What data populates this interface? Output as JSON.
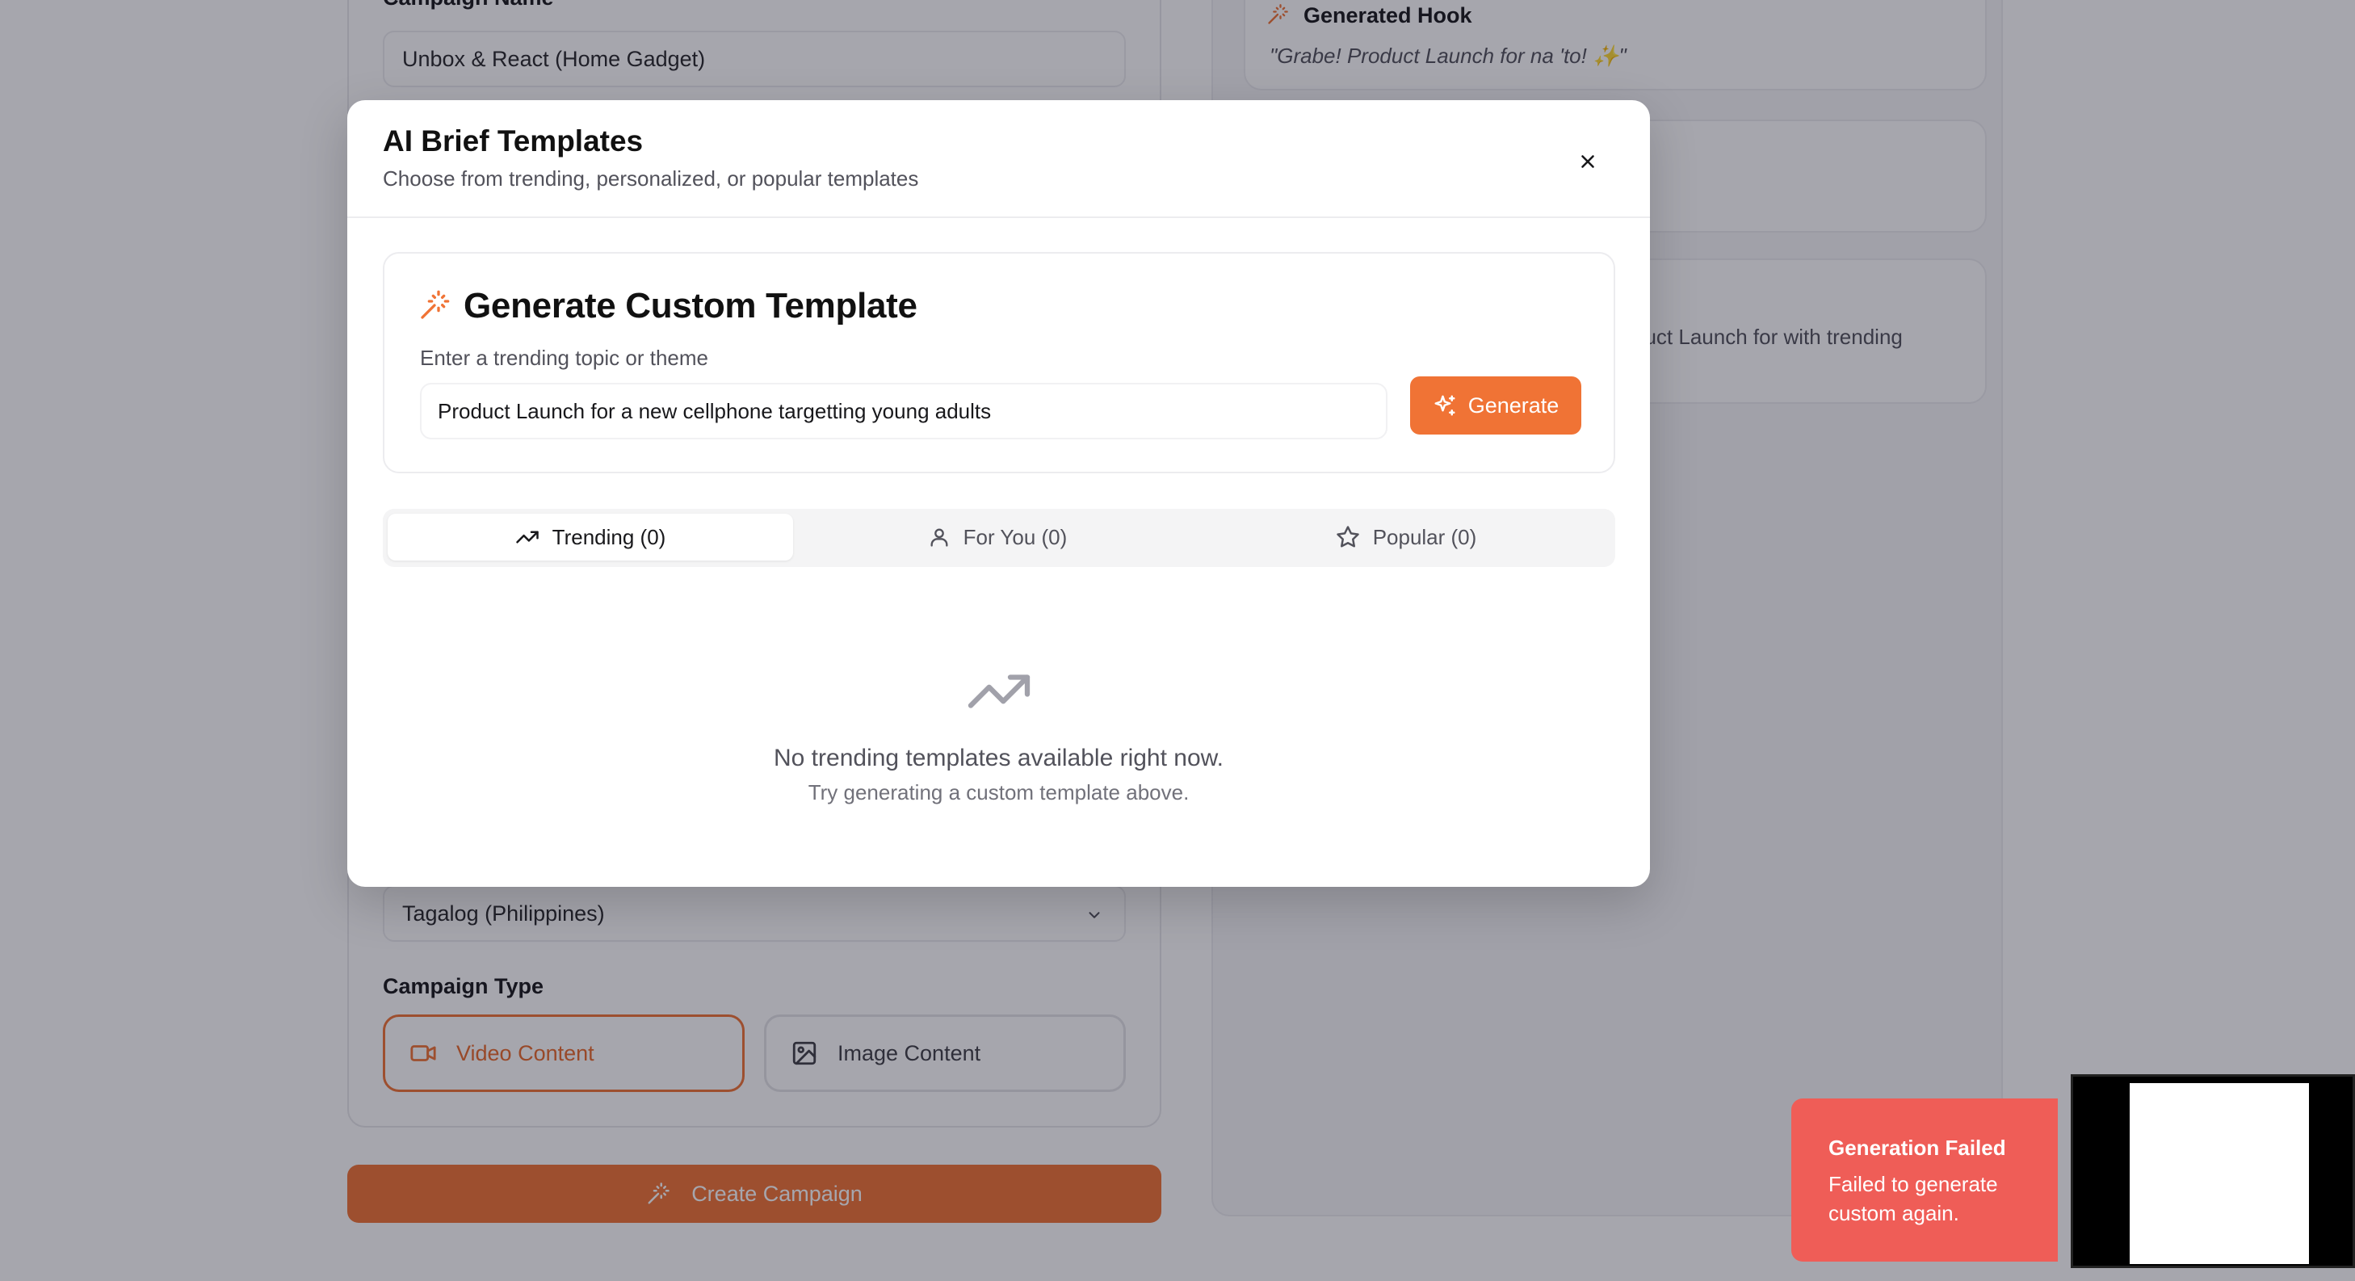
{
  "background": {
    "campaign_name_label": "Campaign Name",
    "campaign_name_value": "Unbox & React (Home Gadget)",
    "language_value": "Tagalog (Philippines)",
    "campaign_type_label": "Campaign Type",
    "video_content_label": "Video Content",
    "image_content_label": "Image Content",
    "create_campaign_label": "Create Campaign",
    "generated_hook_label": "Generated Hook",
    "generated_hook_text": "\"Grabe! Product Launch for na 'to! ✨\"",
    "partial_text": "duct Launch for with trending"
  },
  "modal": {
    "title": "AI Brief Templates",
    "subtitle": "Choose from trending, personalized, or popular templates",
    "generate_card": {
      "title": "Generate Custom Template",
      "input_label": "Enter a trending topic or theme",
      "input_value": "Product Launch for a new cellphone targetting young adults",
      "button_label": "Generate"
    },
    "tabs": [
      {
        "label": "Trending (0)",
        "icon": "trending-up-icon",
        "active": true
      },
      {
        "label": "For You (0)",
        "icon": "user-icon",
        "active": false
      },
      {
        "label": "Popular (0)",
        "icon": "star-icon",
        "active": false
      }
    ],
    "empty_state": {
      "title": "No trending templates available right now.",
      "subtitle": "Try generating a custom template above."
    }
  },
  "toast": {
    "title": "Generation Failed",
    "description": "Failed to generate custom again."
  },
  "colors": {
    "accent": "#f07335",
    "toast": "#ef5d57"
  }
}
